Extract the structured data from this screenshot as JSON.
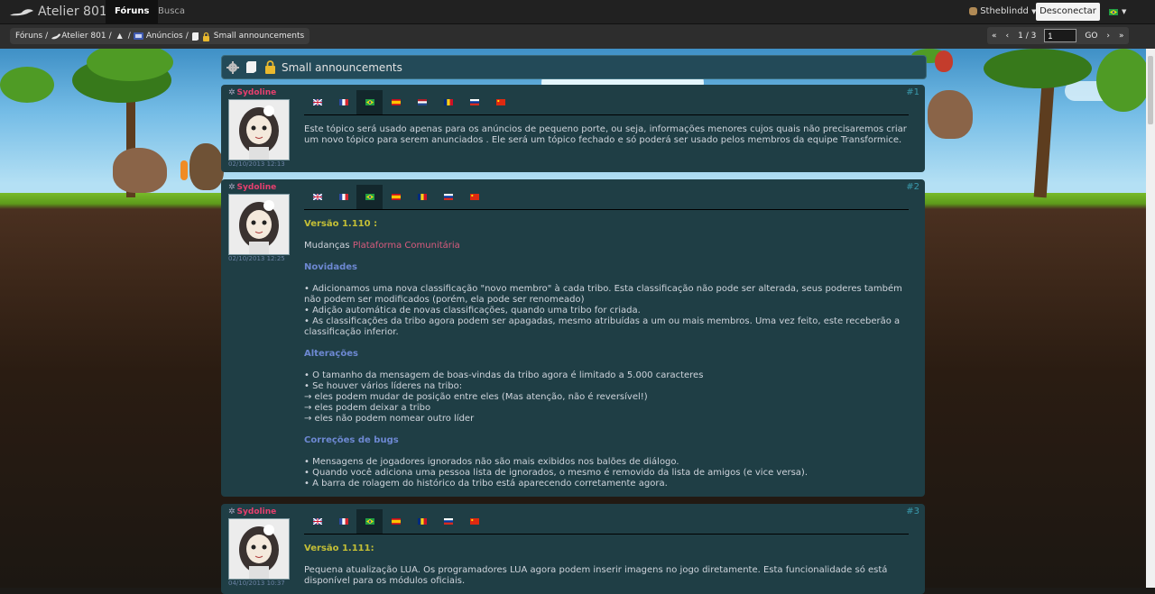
{
  "nav": {
    "logo_text": "Atelier 801",
    "tab_forums": "Fóruns",
    "tab_search": "Busca",
    "user_name": "Stheblindd",
    "disconnect_label": "Desconectar"
  },
  "breadcrumb": {
    "forums": "Fóruns",
    "atelier": "Atelier 801",
    "announcements": "Anúncios",
    "topic": "Small announcements"
  },
  "pagination": {
    "first": "«",
    "prev": "‹",
    "page_info": "1 / 3",
    "page_input": "1",
    "go_label": "GO",
    "next": "›",
    "last": "»"
  },
  "topic": {
    "title": "Small announcements"
  },
  "language_flags": [
    "gb",
    "fr",
    "br",
    "es",
    "nl",
    "ro",
    "ru",
    "cn"
  ],
  "colors": {
    "accent_pink": "#e73f6e",
    "version_yellow": "#c4bf36",
    "section_blue": "#6d88d2",
    "post_bg": "#1f3e45"
  },
  "posts": [
    {
      "author": "Sydoline",
      "date": "02/10/2013 12:13",
      "number": "#1",
      "text": "Este tópico será usado apenas para os anúncios de pequeno porte, ou seja, informações menores cujos quais não precisaremos criar um novo tópico para serem anunciados . Ele será um tópico fechado e só poderá ser usado pelos membros da equipe Transformice."
    },
    {
      "author": "Sydoline",
      "date": "02/10/2013 12:25",
      "number": "#2",
      "version": "Versão 1.110 :",
      "changes_prefix": "Mudanças",
      "changes_link": "Plataforma Comunitária",
      "section_news": "Novidades",
      "news": [
        "• Adicionamos uma nova classificação \"novo membro\" à cada tribo. Esta classificação não pode ser alterada, seus poderes também não podem ser modificados (porém, ela pode ser renomeado)",
        "• Adição automática de novas classificações, quando uma tribo for criada.",
        "• As classificações da tribo agora podem ser apagadas, mesmo atribuídas a um ou mais membros. Uma vez feito, este receberão a classificação inferior."
      ],
      "section_changes": "Alterações",
      "changes": [
        "• O tamanho da mensagem de boas-vindas da tribo agora é limitado a 5.000 caracteres",
        "• Se houver vários líderes na tribo:",
        "→ eles podem mudar de posição entre eles (Mas atenção, não é reversível!)",
        "→ eles podem deixar a tribo",
        "→ eles não podem nomear outro líder"
      ],
      "section_bugs": "Correções de bugs",
      "bugs": [
        "• Mensagens de jogadores ignorados não são mais exibidos nos balões de diálogo.",
        "• Quando você adiciona uma pessoa lista de ignorados, o mesmo é removido da lista de amigos (e vice versa).",
        "• A barra de rolagem do histórico da tribo está aparecendo corretamente agora."
      ]
    },
    {
      "author": "Sydoline",
      "date": "04/10/2013 10:37",
      "number": "#3",
      "version": "Versão 1.111:",
      "text": "Pequena atualização LUA. Os programadores LUA agora podem inserir imagens no jogo diretamente. Esta funcionalidade só está disponível para os módulos oficiais."
    }
  ]
}
